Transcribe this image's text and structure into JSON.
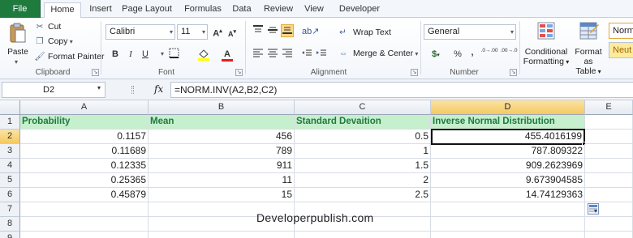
{
  "ribbon_tabs": [
    "File",
    "Home",
    "Insert",
    "Page Layout",
    "Formulas",
    "Data",
    "Review",
    "View",
    "Developer"
  ],
  "active_tab": "Home",
  "clipboard": {
    "paste": "Paste",
    "cut": "Cut",
    "copy": "Copy",
    "format_painter": "Format Painter",
    "group": "Clipboard"
  },
  "font": {
    "name": "Calibri",
    "size": "11",
    "bold": "B",
    "italic": "I",
    "underline": "U",
    "grow": "A",
    "shrink": "A",
    "font_color_glyph": "A",
    "group": "Font"
  },
  "alignment": {
    "wrap_text": "Wrap Text",
    "merge_center": "Merge & Center",
    "group": "Alignment"
  },
  "number": {
    "format": "General",
    "currency": "$",
    "percent": "%",
    "comma": ",",
    "inc_decimal": ".0→.00",
    "dec_decimal": ".00→.0",
    "group": "Number"
  },
  "styles": {
    "conditional": "Conditional",
    "conditional2": "Formatting",
    "format_table": "Format as",
    "format_table2": "Table",
    "normal": "Norm",
    "neutral": "Neut"
  },
  "formula_bar": {
    "name_box": "D2",
    "fx": "fx",
    "formula": "=NORM.INV(A2,B2,C2)"
  },
  "columns": [
    "A",
    "B",
    "C",
    "D",
    "E"
  ],
  "selected_column": "D",
  "rows": [
    "1",
    "2",
    "3",
    "4",
    "5",
    "6",
    "7",
    "8",
    "9"
  ],
  "selected_row": "2",
  "headers": [
    "Probability",
    "Mean",
    "Standard Devaition",
    "Inverse Normal Distribution"
  ],
  "data": [
    [
      "0.1157",
      "456",
      "0.5",
      "455.4016199"
    ],
    [
      "0.11689",
      "789",
      "1",
      "787.809322"
    ],
    [
      "0.12335",
      "911",
      "1.5",
      "909.2623969"
    ],
    [
      "0.25365",
      "11",
      "2",
      "9.673904585"
    ],
    [
      "0.45879",
      "15",
      "2.5",
      "14.74129363"
    ]
  ],
  "watermark": "Developerpublish.com",
  "colors": {
    "file_tab": "#1f7a3e",
    "header_fill": "#c6efce",
    "header_text": "#1f7a3e",
    "selected_header": "#f5c95e"
  }
}
